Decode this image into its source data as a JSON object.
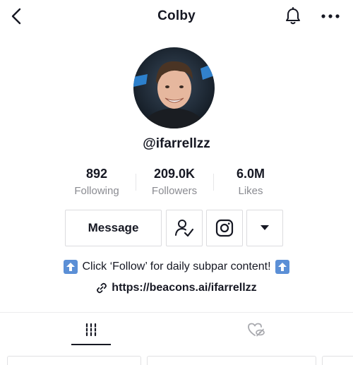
{
  "header": {
    "title": "Colby",
    "back_icon": "chevron-left-icon",
    "bell_icon": "bell-icon",
    "more_icon": "more-horizontal-icon"
  },
  "profile": {
    "username": "@ifarrellzz",
    "avatar_icon": "avatar-photo"
  },
  "stats": {
    "following": {
      "value": "892",
      "label": "Following"
    },
    "followers": {
      "value": "209.0K",
      "label": "Followers"
    },
    "likes": {
      "value": "6.0M",
      "label": "Likes"
    }
  },
  "actions": {
    "message_label": "Message",
    "following_icon": "user-check-icon",
    "instagram_icon": "instagram-icon",
    "dropdown_icon": "caret-down-icon"
  },
  "bio": {
    "text": "Click ‘Follow’ for daily subpar content!",
    "emoji_icon": "up-arrow-emoji-icon",
    "link_icon": "link-icon",
    "link": "https://beacons.ai/ifarrellzz"
  },
  "tabs": {
    "videos_icon": "grid-bars-icon",
    "liked_icon": "hidden-heart-icon",
    "active": "videos"
  },
  "colors": {
    "text": "#161823",
    "muted": "#8a8b91",
    "border": "#dcdcdf",
    "emoji_blue": "#5b8fd6"
  }
}
